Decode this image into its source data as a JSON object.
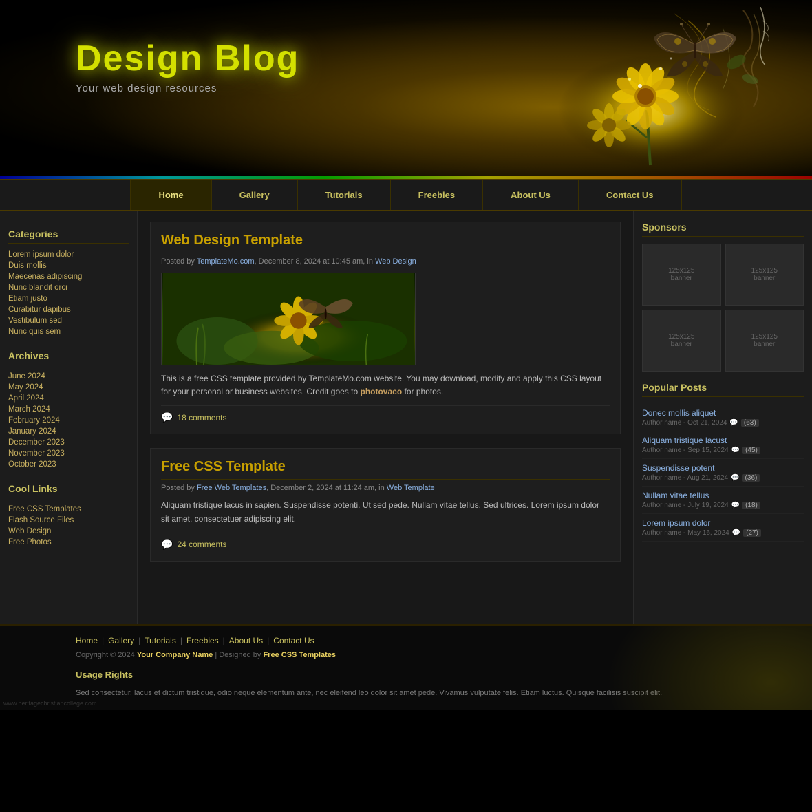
{
  "header": {
    "title": "Design Blog",
    "subtitle": "Your web design resources"
  },
  "nav": {
    "items": [
      {
        "label": "Home",
        "active": true
      },
      {
        "label": "Gallery"
      },
      {
        "label": "Tutorials"
      },
      {
        "label": "Freebies"
      },
      {
        "label": "About Us"
      },
      {
        "label": "Contact Us"
      }
    ]
  },
  "sidebar": {
    "categories_title": "Categories",
    "categories": [
      "Lorem ipsum dolor",
      "Duis mollis",
      "Maecenas adipiscing",
      "Nunc blandit orci",
      "Etiam justo",
      "Curabitur dapibus",
      "Vestibulum sed",
      "Nunc quis sem"
    ],
    "archives_title": "Archives",
    "archives": [
      "June 2024",
      "May 2024",
      "April 2024",
      "March 2024",
      "February 2024",
      "January 2024",
      "December 2023",
      "November 2023",
      "October 2023"
    ],
    "cool_links_title": "Cool Links",
    "cool_links": [
      "Free CSS Templates",
      "Flash Source Files",
      "Web Design",
      "Free Photos"
    ]
  },
  "posts": [
    {
      "title": "Web Design Template",
      "meta_author": "TemplateMo.com",
      "meta_date": "December 8, 2024 at 10:45 am",
      "meta_category": "Web Design",
      "body": "This is a free CSS template provided by TemplateMo.com website. You may download, modify and apply this CSS layout for your personal or business websites. Credit goes to",
      "body_link": "photovaco",
      "body_end": "for photos.",
      "comments": "18 comments"
    },
    {
      "title": "Free CSS Template",
      "meta_author": "Free Web Templates",
      "meta_date": "December 2, 2024 at 11:24 am",
      "meta_category": "Web Template",
      "body": "Aliquam tristique lacus in sapien. Suspendisse potenti. Ut sed pede. Nullam vitae tellus. Sed ultrices. Lorem ipsum dolor sit amet, consectetuer adipiscing elit.",
      "comments": "24 comments"
    }
  ],
  "right_sidebar": {
    "sponsors_title": "Sponsors",
    "banners": [
      {
        "label": "125x125\nbanner"
      },
      {
        "label": "125x125\nbanner"
      },
      {
        "label": "125x125\nbanner"
      },
      {
        "label": "125x125\nbanner"
      }
    ],
    "popular_posts_title": "Popular Posts",
    "popular_posts": [
      {
        "title": "Donec mollis aliquet",
        "meta": "Author name - Oct 21, 2024",
        "comments": "63"
      },
      {
        "title": "Aliquam tristique lacust",
        "meta": "Author name - Sep 15, 2024",
        "comments": "45"
      },
      {
        "title": "Suspendisse potent",
        "meta": "Author name - Aug 21, 2024",
        "comments": "36"
      },
      {
        "title": "Nullam vitae tellus",
        "meta": "Author name - July 19, 2024",
        "comments": "18"
      },
      {
        "title": "Lorem ipsum dolor",
        "meta": "Author name - May 16, 2024",
        "comments": "27"
      }
    ]
  },
  "footer": {
    "nav_items": [
      "Home",
      "Gallery",
      "Tutorials",
      "Freebies",
      "About Us",
      "Contact Us"
    ],
    "copyright": "Copyright © 2024",
    "company": "Your Company Name",
    "designed_by": "Designed by",
    "designer": "Free CSS Templates",
    "usage_title": "Usage Rights",
    "usage_text": "Sed consectetur, lacus et dictum tristique, odio neque elementum ante, nec eleifend leo dolor sit amet pede. Vivamus vulputate felis. Etiam luctus. Quisque facilisis suscipit elit."
  }
}
